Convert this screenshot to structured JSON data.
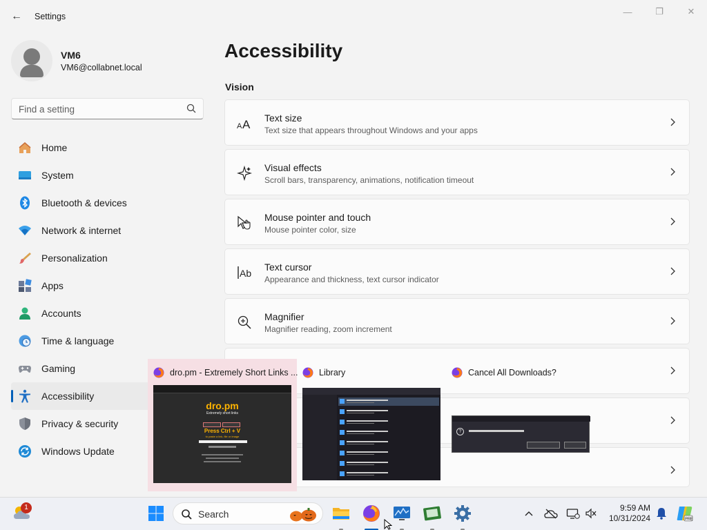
{
  "window": {
    "title": "Settings",
    "back_glyph": "←",
    "minimize_glyph": "—",
    "maximize_glyph": "❐",
    "close_glyph": "✕"
  },
  "profile": {
    "name": "VM6",
    "email": "VM6@collabnet.local"
  },
  "search": {
    "placeholder": "Find a setting"
  },
  "nav": {
    "items": [
      {
        "label": "Home",
        "icon": "home-icon"
      },
      {
        "label": "System",
        "icon": "system-icon"
      },
      {
        "label": "Bluetooth & devices",
        "icon": "bluetooth-icon"
      },
      {
        "label": "Network & internet",
        "icon": "network-icon"
      },
      {
        "label": "Personalization",
        "icon": "brush-icon"
      },
      {
        "label": "Apps",
        "icon": "apps-icon"
      },
      {
        "label": "Accounts",
        "icon": "accounts-icon"
      },
      {
        "label": "Time & language",
        "icon": "clock-globe-icon"
      },
      {
        "label": "Gaming",
        "icon": "gamepad-icon"
      },
      {
        "label": "Accessibility",
        "icon": "accessibility-icon",
        "active": true
      },
      {
        "label": "Privacy & security",
        "icon": "shield-icon"
      },
      {
        "label": "Windows Update",
        "icon": "update-icon"
      }
    ]
  },
  "main": {
    "title": "Accessibility",
    "section": "Vision",
    "cards": [
      {
        "title": "Text size",
        "subtitle": "Text size that appears throughout Windows and your apps",
        "icon": "text-size-icon"
      },
      {
        "title": "Visual effects",
        "subtitle": "Scroll bars, transparency, animations, notification timeout",
        "icon": "visual-effects-icon"
      },
      {
        "title": "Mouse pointer and touch",
        "subtitle": "Mouse pointer color, size",
        "icon": "mouse-pointer-icon"
      },
      {
        "title": "Text cursor",
        "subtitle": "Appearance and thickness, text cursor indicator",
        "icon": "text-cursor-icon"
      },
      {
        "title": "Magnifier",
        "subtitle": "Magnifier reading, zoom increment",
        "icon": "magnifier-icon"
      },
      {
        "title": "",
        "subtitle": "",
        "icon": ""
      },
      {
        "title": "",
        "subtitle": "",
        "icon": ""
      },
      {
        "title": "",
        "subtitle": "",
        "icon": ""
      }
    ]
  },
  "thumbnails": {
    "items": [
      {
        "title": "dro.pm - Extremely Short Links ...",
        "icon": "firefox-icon",
        "hover": true,
        "preview": {
          "logo": "dro.pm",
          "tagline": "Extremely short links",
          "action": "Press Ctrl + V",
          "action_sub": "to paste a link, file or image"
        }
      },
      {
        "title": "Library",
        "icon": "firefox-icon"
      },
      {
        "title": "Cancel All Downloads?",
        "icon": "firefox-icon",
        "preview": {
          "question_glyph": "?"
        }
      }
    ]
  },
  "taskbar": {
    "search_label": "Search",
    "weather_badge": "1",
    "time": "9:59 AM",
    "date": "10/31/2024",
    "tray_chevron": "⌃",
    "colors": {
      "accent": "#005fb8",
      "badge": "#c42b1c"
    }
  }
}
